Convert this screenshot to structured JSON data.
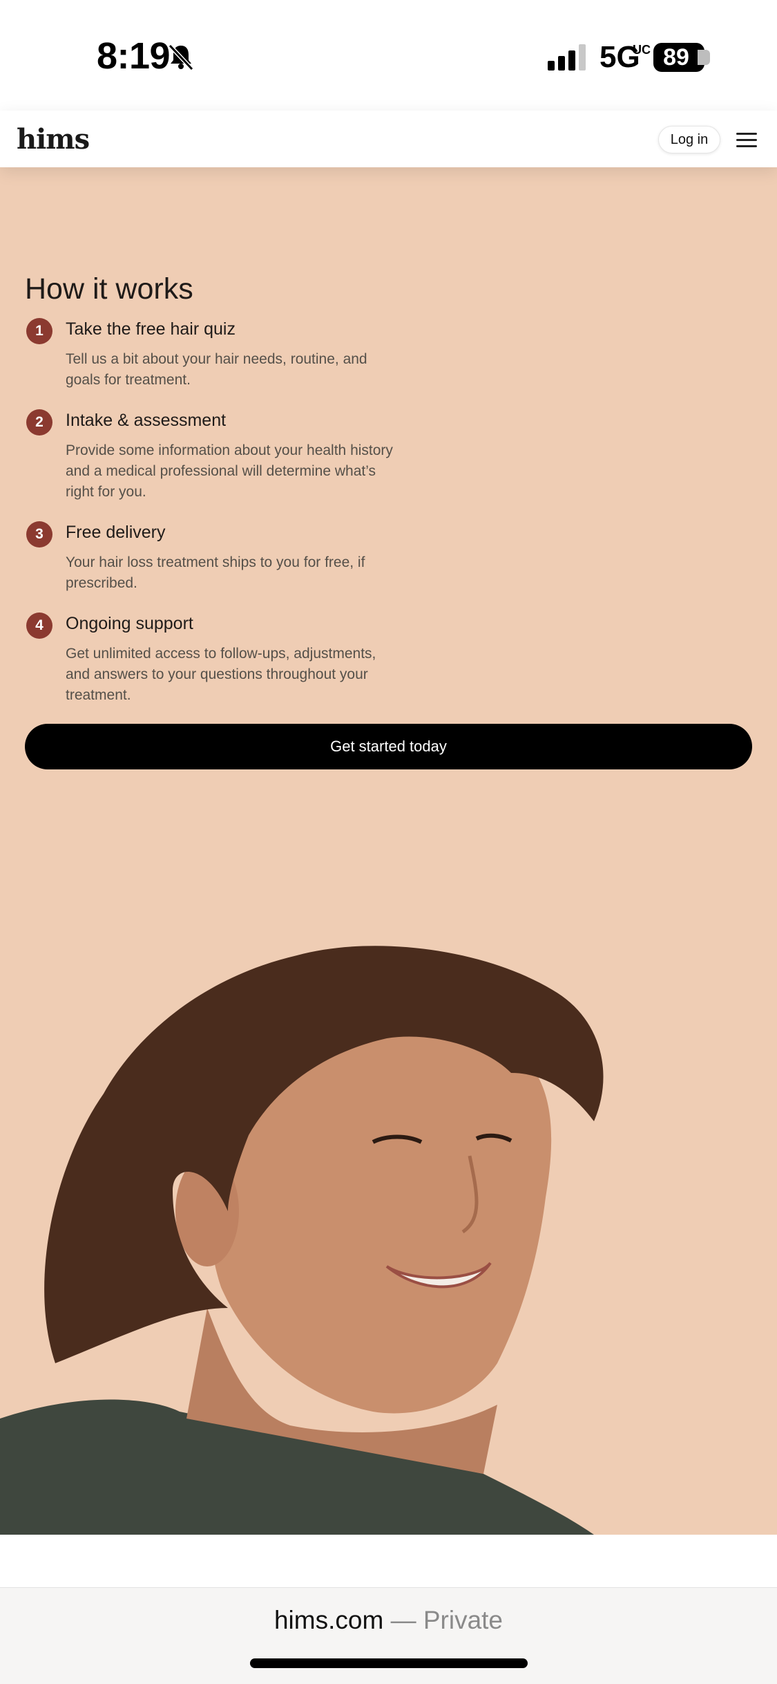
{
  "status_bar": {
    "time": "8:19",
    "network": "5G",
    "network_suffix": "UC",
    "battery": "89",
    "icons": [
      "bell-slash-icon",
      "signal-icon",
      "battery-icon"
    ]
  },
  "header": {
    "logo": "hims",
    "login_label": "Log in",
    "menu_icon": "hamburger-menu-icon"
  },
  "how_it_works": {
    "title": "How it works",
    "steps": [
      {
        "number": "1",
        "title": "Take the free hair quiz",
        "desc": "Tell us a bit about your hair needs, routine, and goals for treatment."
      },
      {
        "number": "2",
        "title": "Intake & assessment",
        "desc": "Provide some information about your health history and a medical professional will determine what’s right for you."
      },
      {
        "number": "3",
        "title": "Free delivery",
        "desc": "Your hair loss treatment ships to you for free, if prescribed."
      },
      {
        "number": "4",
        "title": "Ongoing support",
        "desc": "Get unlimited access to follow-ups, adjustments, and answers to your questions throughout your treatment."
      }
    ],
    "cta_label": "Get started today"
  },
  "colors": {
    "background": "#efcdb4",
    "badge": "#8b3a30",
    "cta": "#000000"
  },
  "browser": {
    "domain": "hims.com",
    "suffix": "— Private"
  }
}
